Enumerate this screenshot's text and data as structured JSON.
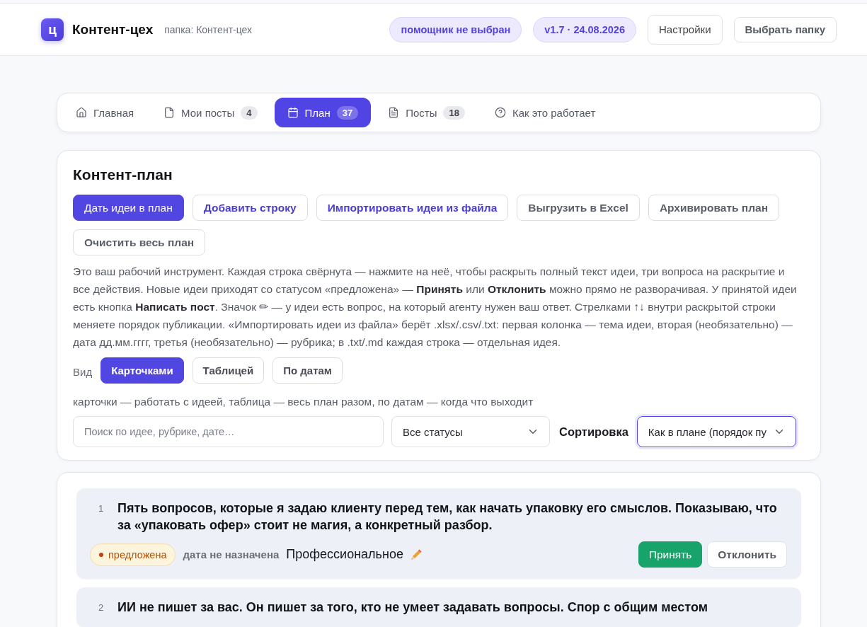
{
  "header": {
    "logo_letter": "ц",
    "brand": "Контент-цех",
    "folder": "папка: Контент-цех",
    "assistant_status": "помощник не выбран",
    "version": "v1.7 · 24.08.2026",
    "buttons": [
      {
        "label": "Настройки",
        "kind": "tall"
      },
      {
        "label": "Выбрать папку",
        "kind": "strong"
      }
    ]
  },
  "tabs": [
    {
      "label": "Главная",
      "selected": false
    },
    {
      "label": "Мои посты",
      "count": "4",
      "selected": false
    },
    {
      "label": "План",
      "count": "37",
      "selected": true
    },
    {
      "label": "Посты",
      "count": "18",
      "selected": false
    },
    {
      "label": "Как это работает",
      "selected": false
    }
  ],
  "plan": {
    "title": "Контент-план",
    "actions": [
      {
        "label": "Дать идеи в план",
        "kind": "primary"
      },
      {
        "label": "Добавить строку",
        "kind": "accent"
      },
      {
        "label": "Импортировать идеи из файла",
        "kind": "accent"
      },
      {
        "label": "Выгрузить в Excel",
        "kind": "plain"
      },
      {
        "label": "Архивировать план",
        "kind": "plain"
      },
      {
        "label": "Очистить весь план",
        "kind": "plain"
      }
    ],
    "description": "Это ваш рабочий инструмент. Каждая строка свёрнута — нажмите на неё, чтобы раскрыть полный текст идеи, три вопроса на раскрытие и все действия. Новые идеи приходят со статусом «предложена» — **Принять** или **Отклонить** можно прямо не разворачивая. У принятой идеи есть кнопка **Написать пост**. Значок ✏ — у идеи есть вопрос, на который агенту нужен ваш ответ. Стрелками ↑↓ внутри раскрытой строки меняете порядок публикации. «Импортировать идеи из файла» берёт .xlsx/.csv/.txt: первая колонка — тема идеи, вторая (необязательно) — дата дд.мм.гггг, третья (необязательно) — рубрика; в .txt/.md каждая строка — отдельная идея.",
    "view": {
      "label": "Вид",
      "options": [
        {
          "label": "Карточками",
          "selected": true
        },
        {
          "label": "Таблицей",
          "selected": false
        },
        {
          "label": "По датам",
          "selected": false
        }
      ],
      "hint": "карточки — работать с идеей, таблица — весь план разом, по датам — когда что выходит"
    },
    "filters": {
      "search_placeholder": "Поиск по идее, рубрике, дате…",
      "status": {
        "value": "Все статусы",
        "focused": false
      },
      "sort_label": "Сортировка",
      "sort": {
        "value": "Как в плане (порядок пу",
        "focused": true
      }
    }
  },
  "ideas": [
    {
      "number": "1",
      "title": "Пять вопросов, которые я задаю клиенту перед тем, как начать упаковку его смыслов. Показываю, что за «упаковать офер» стоит не магия, а конкретный разбор.",
      "status": {
        "kind": "proposed",
        "label": "предложена"
      },
      "date": "дата не назначена",
      "rubric": "Профессиональное",
      "has_question": true,
      "actions": [
        {
          "label": "Принять",
          "kind": "accept"
        },
        {
          "label": "Отклонить",
          "kind": "reject"
        }
      ]
    },
    {
      "number": "2",
      "title": "ИИ не пишет за вас. Он пишет за того, кто не умеет задавать вопросы. Спор с общим местом"
    }
  ]
}
